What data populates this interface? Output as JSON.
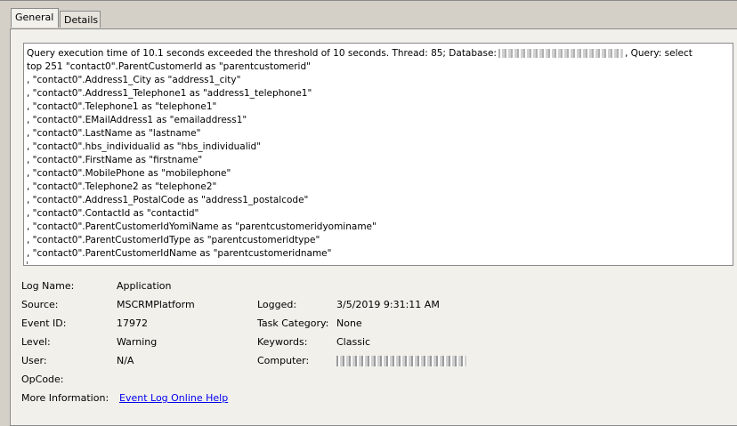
{
  "tabs": [
    {
      "label": "General",
      "active": true
    },
    {
      "label": "Details",
      "active": false
    }
  ],
  "message": {
    "line1_prefix": "Query execution time of 10.1 seconds exceeded the threshold of 10 seconds. Thread: 85; Database:",
    "line1_suffix": ", Query: select",
    "lines": [
      "top 251 \"contact0\".ParentCustomerId as \"parentcustomerid\"",
      ", \"contact0\".Address1_City as \"address1_city\"",
      ", \"contact0\".Address1_Telephone1 as \"address1_telephone1\"",
      ", \"contact0\".Telephone1 as \"telephone1\"",
      ", \"contact0\".EMailAddress1 as \"emailaddress1\"",
      ", \"contact0\".LastName as \"lastname\"",
      ", \"contact0\".hbs_individualid as \"hbs_individualid\"",
      ", \"contact0\".FirstName as \"firstname\"",
      ", \"contact0\".MobilePhone as \"mobilephone\"",
      ", \"contact0\".Telephone2 as \"telephone2\"",
      ", \"contact0\".Address1_PostalCode as \"address1_postalcode\"",
      ", \"contact0\".ContactId as \"contactid\"",
      ", \"contact0\".ParentCustomerIdYomiName as \"parentcustomeridyominame\"",
      ", \"contact0\".ParentCustomerIdType as \"parentcustomeridtype\"",
      ", \"contact0\".ParentCustomerIdName as \"parentcustomeridname\""
    ]
  },
  "fields": {
    "log_name_label": "Log Name:",
    "log_name_value": "Application",
    "source_label": "Source:",
    "source_value": "MSCRMPlatform",
    "logged_label": "Logged:",
    "logged_value": "3/5/2019 9:31:11 AM",
    "event_id_label": "Event ID:",
    "event_id_value": "17972",
    "task_category_label": "Task Category:",
    "task_category_value": "None",
    "level_label": "Level:",
    "level_value": "Warning",
    "keywords_label": "Keywords:",
    "keywords_value": "Classic",
    "user_label": "User:",
    "user_value": "N/A",
    "computer_label": "Computer:",
    "opcode_label": "OpCode:",
    "more_info_label": "More Information:",
    "more_info_link": "Event Log Online Help"
  }
}
